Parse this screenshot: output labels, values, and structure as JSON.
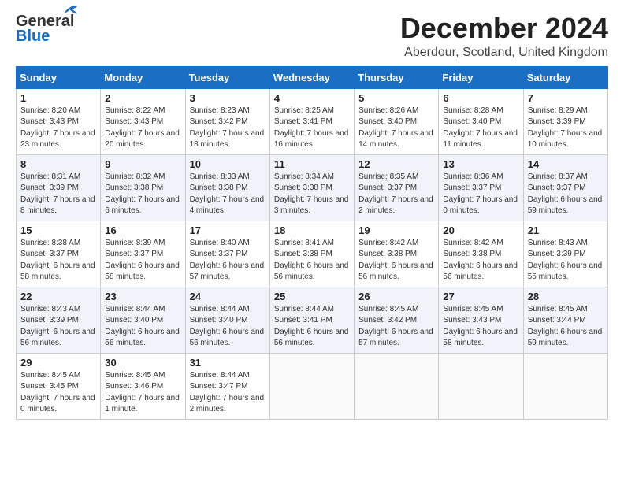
{
  "logo": {
    "line1": "General",
    "line2": "Blue"
  },
  "title": "December 2024",
  "location": "Aberdour, Scotland, United Kingdom",
  "days_of_week": [
    "Sunday",
    "Monday",
    "Tuesday",
    "Wednesday",
    "Thursday",
    "Friday",
    "Saturday"
  ],
  "weeks": [
    [
      {
        "day": 1,
        "sunrise": "8:20 AM",
        "sunset": "3:43 PM",
        "daylight": "7 hours and 23 minutes."
      },
      {
        "day": 2,
        "sunrise": "8:22 AM",
        "sunset": "3:43 PM",
        "daylight": "7 hours and 20 minutes."
      },
      {
        "day": 3,
        "sunrise": "8:23 AM",
        "sunset": "3:42 PM",
        "daylight": "7 hours and 18 minutes."
      },
      {
        "day": 4,
        "sunrise": "8:25 AM",
        "sunset": "3:41 PM",
        "daylight": "7 hours and 16 minutes."
      },
      {
        "day": 5,
        "sunrise": "8:26 AM",
        "sunset": "3:40 PM",
        "daylight": "7 hours and 14 minutes."
      },
      {
        "day": 6,
        "sunrise": "8:28 AM",
        "sunset": "3:40 PM",
        "daylight": "7 hours and 11 minutes."
      },
      {
        "day": 7,
        "sunrise": "8:29 AM",
        "sunset": "3:39 PM",
        "daylight": "7 hours and 10 minutes."
      }
    ],
    [
      {
        "day": 8,
        "sunrise": "8:31 AM",
        "sunset": "3:39 PM",
        "daylight": "7 hours and 8 minutes."
      },
      {
        "day": 9,
        "sunrise": "8:32 AM",
        "sunset": "3:38 PM",
        "daylight": "7 hours and 6 minutes."
      },
      {
        "day": 10,
        "sunrise": "8:33 AM",
        "sunset": "3:38 PM",
        "daylight": "7 hours and 4 minutes."
      },
      {
        "day": 11,
        "sunrise": "8:34 AM",
        "sunset": "3:38 PM",
        "daylight": "7 hours and 3 minutes."
      },
      {
        "day": 12,
        "sunrise": "8:35 AM",
        "sunset": "3:37 PM",
        "daylight": "7 hours and 2 minutes."
      },
      {
        "day": 13,
        "sunrise": "8:36 AM",
        "sunset": "3:37 PM",
        "daylight": "7 hours and 0 minutes."
      },
      {
        "day": 14,
        "sunrise": "8:37 AM",
        "sunset": "3:37 PM",
        "daylight": "6 hours and 59 minutes."
      }
    ],
    [
      {
        "day": 15,
        "sunrise": "8:38 AM",
        "sunset": "3:37 PM",
        "daylight": "6 hours and 58 minutes."
      },
      {
        "day": 16,
        "sunrise": "8:39 AM",
        "sunset": "3:37 PM",
        "daylight": "6 hours and 58 minutes."
      },
      {
        "day": 17,
        "sunrise": "8:40 AM",
        "sunset": "3:37 PM",
        "daylight": "6 hours and 57 minutes."
      },
      {
        "day": 18,
        "sunrise": "8:41 AM",
        "sunset": "3:38 PM",
        "daylight": "6 hours and 56 minutes."
      },
      {
        "day": 19,
        "sunrise": "8:42 AM",
        "sunset": "3:38 PM",
        "daylight": "6 hours and 56 minutes."
      },
      {
        "day": 20,
        "sunrise": "8:42 AM",
        "sunset": "3:38 PM",
        "daylight": "6 hours and 56 minutes."
      },
      {
        "day": 21,
        "sunrise": "8:43 AM",
        "sunset": "3:39 PM",
        "daylight": "6 hours and 55 minutes."
      }
    ],
    [
      {
        "day": 22,
        "sunrise": "8:43 AM",
        "sunset": "3:39 PM",
        "daylight": "6 hours and 56 minutes."
      },
      {
        "day": 23,
        "sunrise": "8:44 AM",
        "sunset": "3:40 PM",
        "daylight": "6 hours and 56 minutes."
      },
      {
        "day": 24,
        "sunrise": "8:44 AM",
        "sunset": "3:40 PM",
        "daylight": "6 hours and 56 minutes."
      },
      {
        "day": 25,
        "sunrise": "8:44 AM",
        "sunset": "3:41 PM",
        "daylight": "6 hours and 56 minutes."
      },
      {
        "day": 26,
        "sunrise": "8:45 AM",
        "sunset": "3:42 PM",
        "daylight": "6 hours and 57 minutes."
      },
      {
        "day": 27,
        "sunrise": "8:45 AM",
        "sunset": "3:43 PM",
        "daylight": "6 hours and 58 minutes."
      },
      {
        "day": 28,
        "sunrise": "8:45 AM",
        "sunset": "3:44 PM",
        "daylight": "6 hours and 59 minutes."
      }
    ],
    [
      {
        "day": 29,
        "sunrise": "8:45 AM",
        "sunset": "3:45 PM",
        "daylight": "7 hours and 0 minutes."
      },
      {
        "day": 30,
        "sunrise": "8:45 AM",
        "sunset": "3:46 PM",
        "daylight": "7 hours and 1 minute."
      },
      {
        "day": 31,
        "sunrise": "8:44 AM",
        "sunset": "3:47 PM",
        "daylight": "7 hours and 2 minutes."
      },
      null,
      null,
      null,
      null
    ]
  ]
}
